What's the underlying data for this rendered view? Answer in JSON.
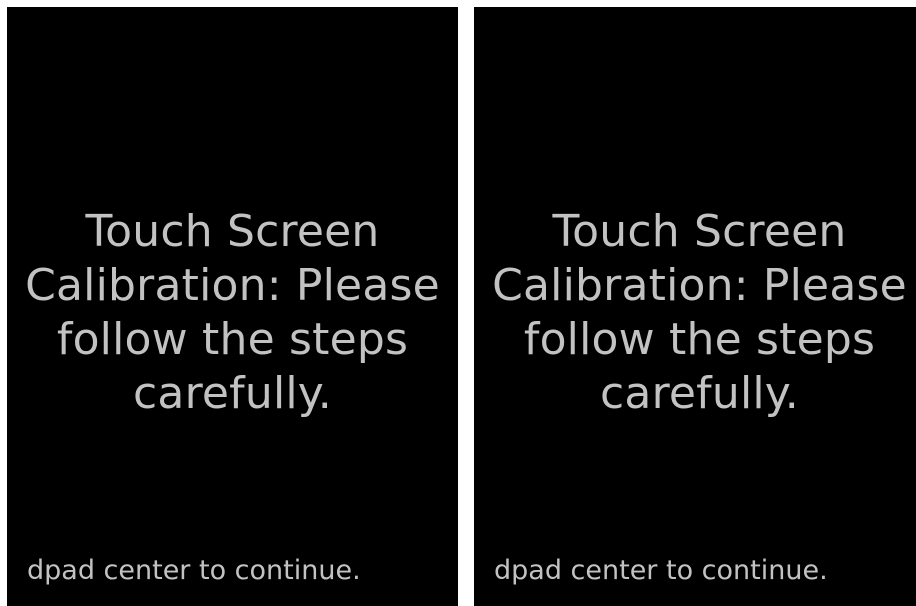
{
  "screens": [
    {
      "title": "Touch Screen Calibration: Please follow the steps carefully.",
      "hint": "dpad center to continue."
    },
    {
      "title": "Touch Screen Calibration: Please follow the steps carefully.",
      "hint": "dpad center to continue."
    }
  ],
  "colors": {
    "screen_background": "#000000",
    "text": "#c2c2c2",
    "page_background": "#ffffff"
  }
}
